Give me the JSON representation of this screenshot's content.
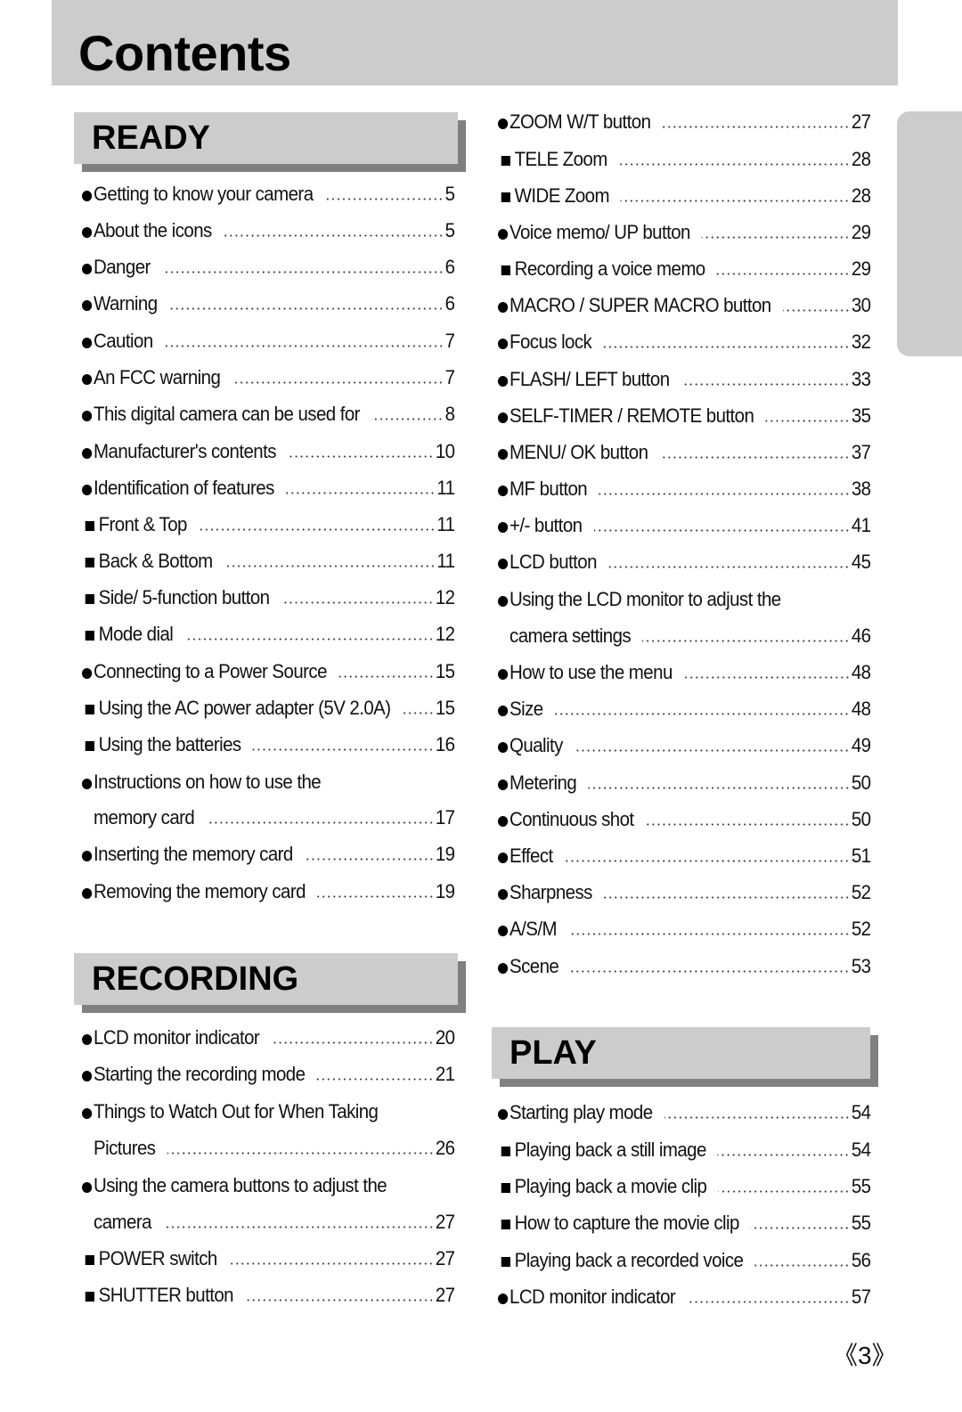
{
  "title": "Contents",
  "page_number": "《3》",
  "sections": {
    "ready": {
      "heading": "READY",
      "entries": [
        {
          "bullet": "circle",
          "text": "Getting to know your camera",
          "page": "5"
        },
        {
          "bullet": "circle",
          "text": "About the icons",
          "page": "5"
        },
        {
          "bullet": "circle",
          "text": "Danger",
          "page": "6"
        },
        {
          "bullet": "circle",
          "text": "Warning",
          "page": "6"
        },
        {
          "bullet": "circle",
          "text": "Caution",
          "page": "7"
        },
        {
          "bullet": "circle",
          "text": "An FCC warning",
          "page": "7"
        },
        {
          "bullet": "circle",
          "text": "This digital camera can be used for",
          "page": "8"
        },
        {
          "bullet": "circle",
          "text": "Manufacturer's contents",
          "page": "10"
        },
        {
          "bullet": "circle",
          "text": "Identification of features",
          "page": "11"
        },
        {
          "bullet": "square",
          "text": "Front & Top",
          "page": "11"
        },
        {
          "bullet": "square",
          "text": "Back & Bottom",
          "page": "11"
        },
        {
          "bullet": "square",
          "text": "Side/ 5-function button",
          "page": "12"
        },
        {
          "bullet": "square",
          "text": "Mode dial",
          "page": "12"
        },
        {
          "bullet": "circle",
          "text": "Connecting to a Power Source",
          "page": "15"
        },
        {
          "bullet": "square",
          "text": "Using the AC power adapter (5V 2.0A)",
          "page": "15"
        },
        {
          "bullet": "square",
          "text": "Using the batteries",
          "page": "16"
        },
        {
          "bullet": "circle",
          "text": "Instructions on how to use the",
          "page": ""
        },
        {
          "bullet": "none",
          "text": "memory card",
          "page": "17"
        },
        {
          "bullet": "circle",
          "text": "Inserting the memory card",
          "page": "19"
        },
        {
          "bullet": "circle",
          "text": "Removing the memory card",
          "page": "19"
        }
      ]
    },
    "recording": {
      "heading": "RECORDING",
      "entries": [
        {
          "bullet": "circle",
          "text": "LCD monitor indicator",
          "page": "20"
        },
        {
          "bullet": "circle",
          "text": "Starting the recording mode",
          "page": "21"
        },
        {
          "bullet": "circle",
          "text": "Things to Watch Out for When Taking",
          "page": ""
        },
        {
          "bullet": "none",
          "text": "Pictures",
          "page": "26"
        },
        {
          "bullet": "circle",
          "text": "Using the camera buttons to adjust the",
          "page": ""
        },
        {
          "bullet": "none",
          "text": "camera",
          "page": "27"
        },
        {
          "bullet": "square",
          "text": "POWER switch",
          "page": "27"
        },
        {
          "bullet": "square",
          "text": "SHUTTER button",
          "page": "27"
        }
      ],
      "continued": [
        {
          "bullet": "circle",
          "text": "ZOOM W/T button",
          "page": "27"
        },
        {
          "bullet": "square",
          "text": "TELE Zoom",
          "page": "28"
        },
        {
          "bullet": "square",
          "text": "WIDE Zoom",
          "page": "28"
        },
        {
          "bullet": "circle",
          "text": "Voice memo/ UP button",
          "page": "29"
        },
        {
          "bullet": "square",
          "text": "Recording a voice memo",
          "page": "29"
        },
        {
          "bullet": "circle",
          "text": "MACRO / SUPER MACRO button",
          "page": "30"
        },
        {
          "bullet": "circle",
          "text": "Focus lock",
          "page": "32"
        },
        {
          "bullet": "circle",
          "text": "FLASH/ LEFT button",
          "page": "33"
        },
        {
          "bullet": "circle",
          "text": "SELF-TIMER / REMOTE button",
          "page": "35"
        },
        {
          "bullet": "circle",
          "text": "MENU/ OK button",
          "page": "37"
        },
        {
          "bullet": "circle",
          "text": "MF button",
          "page": "38"
        },
        {
          "bullet": "circle",
          "text": "+/- button",
          "page": "41"
        },
        {
          "bullet": "circle",
          "text": "LCD button",
          "page": "45"
        },
        {
          "bullet": "circle",
          "text": "Using the LCD monitor to adjust the",
          "page": ""
        },
        {
          "bullet": "none",
          "text": "camera settings",
          "page": "46"
        },
        {
          "bullet": "circle",
          "text": "How to use the menu",
          "page": "48"
        },
        {
          "bullet": "circle",
          "text": "Size",
          "page": "48"
        },
        {
          "bullet": "circle",
          "text": "Quality",
          "page": "49"
        },
        {
          "bullet": "circle",
          "text": "Metering",
          "page": "50"
        },
        {
          "bullet": "circle",
          "text": "Continuous shot",
          "page": "50"
        },
        {
          "bullet": "circle",
          "text": "Effect",
          "page": "51"
        },
        {
          "bullet": "circle",
          "text": "Sharpness",
          "page": "52"
        },
        {
          "bullet": "circle",
          "text": "A/S/M",
          "page": "52"
        },
        {
          "bullet": "circle",
          "text": "Scene",
          "page": "53"
        }
      ]
    },
    "play": {
      "heading": "PLAY",
      "entries": [
        {
          "bullet": "circle",
          "text": "Starting play mode",
          "page": "54"
        },
        {
          "bullet": "square",
          "text": "Playing back a still image",
          "page": "54"
        },
        {
          "bullet": "square",
          "text": "Playing back a movie clip",
          "page": "55"
        },
        {
          "bullet": "square",
          "text": "How to capture the movie clip",
          "page": "55"
        },
        {
          "bullet": "square",
          "text": "Playing back a recorded voice",
          "page": "56"
        },
        {
          "bullet": "circle",
          "text": "LCD monitor indicator",
          "page": "57"
        }
      ]
    }
  }
}
